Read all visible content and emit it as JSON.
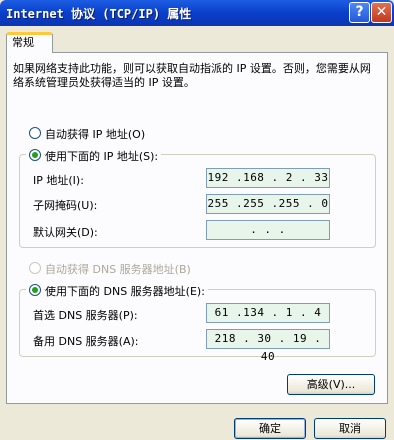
{
  "window": {
    "title": "Internet 协议 (TCP/IP) 属性",
    "help_glyph": "?",
    "close_glyph": "✕"
  },
  "tab": {
    "label": "常规"
  },
  "description": "如果网络支持此功能，则可以获取自动指派的 IP 设置。否则，您需要从网络系统管理员处获得适当的 IP 设置。",
  "ip": {
    "auto_label": "自动获得 IP 地址(O)",
    "manual_label": "使用下面的 IP 地址(S):",
    "selected": "manual",
    "address_label": "IP 地址(I):",
    "address_value": "192 .168 . 2 . 33",
    "mask_label": "子网掩码(U):",
    "mask_value": "255 .255 .255 . 0",
    "gateway_label": "默认网关(D):",
    "gateway_value": " .    .    . "
  },
  "dns": {
    "auto_label": "自动获得 DNS 服务器地址(B)",
    "manual_label": "使用下面的 DNS 服务器地址(E):",
    "selected": "manual",
    "preferred_label": "首选 DNS 服务器(P):",
    "preferred_value": "61 .134 . 1 . 4",
    "alternate_label": "备用 DNS 服务器(A):",
    "alternate_value": "218 . 30 . 19 . 40"
  },
  "buttons": {
    "advanced": "高级(V)...",
    "ok": "确定",
    "cancel": "取消"
  }
}
